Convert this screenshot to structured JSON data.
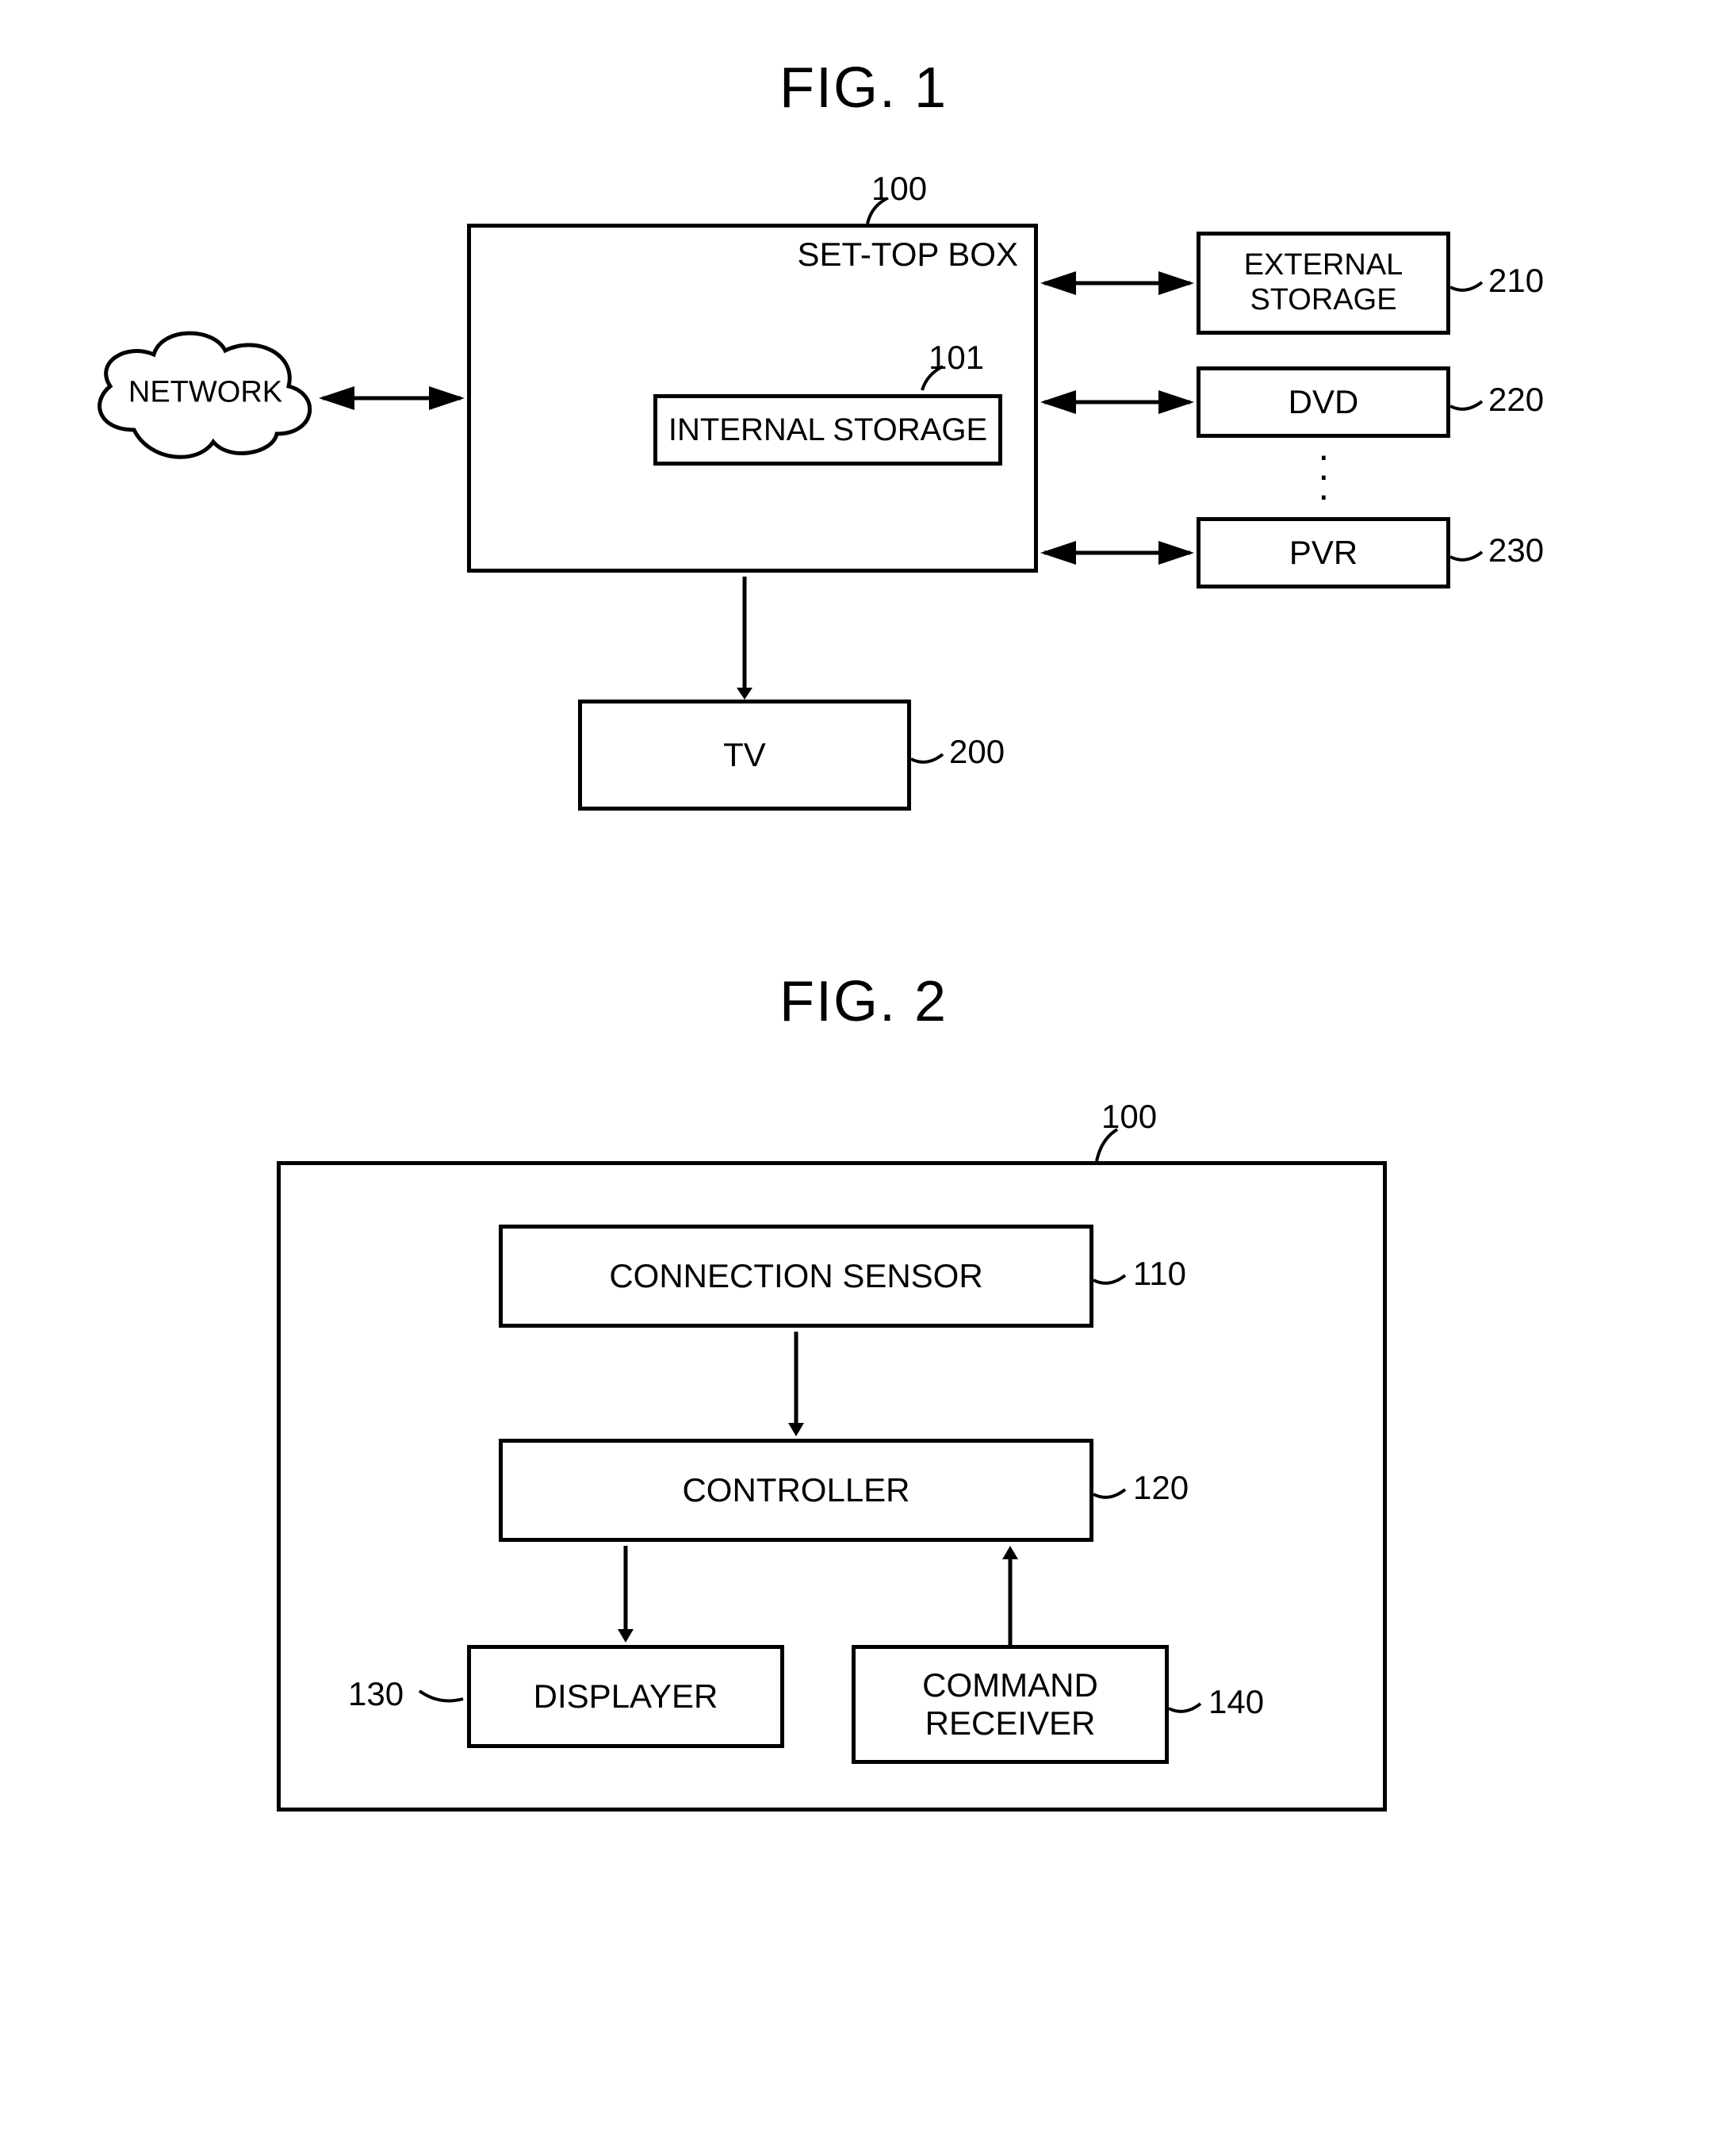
{
  "figures": {
    "fig1": {
      "title": "FIG. 1",
      "network_label": "NETWORK",
      "settop": {
        "label": "SET-TOP BOX",
        "ref": "100",
        "internal_storage": {
          "label": "INTERNAL STORAGE",
          "ref": "101"
        }
      },
      "tv": {
        "label": "TV",
        "ref": "200"
      },
      "ext_storage": {
        "label": "EXTERNAL\nSTORAGE",
        "ref": "210"
      },
      "dvd": {
        "label": "DVD",
        "ref": "220"
      },
      "pvr": {
        "label": "PVR",
        "ref": "230"
      }
    },
    "fig2": {
      "title": "FIG. 2",
      "ref": "100",
      "connection_sensor": {
        "label": "CONNECTION SENSOR",
        "ref": "110"
      },
      "controller": {
        "label": "CONTROLLER",
        "ref": "120"
      },
      "displayer": {
        "label": "DISPLAYER",
        "ref": "130"
      },
      "command_receiver": {
        "label": "COMMAND\nRECEIVER",
        "ref": "140"
      }
    }
  }
}
